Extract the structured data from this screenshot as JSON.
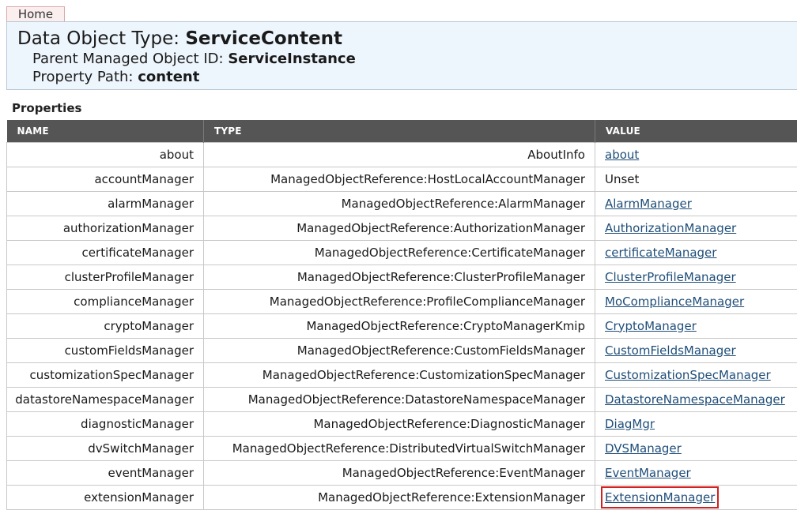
{
  "tab": {
    "label": "Home"
  },
  "header": {
    "title_prefix": "Data Object Type:",
    "title_value": "ServiceContent",
    "parent_label": "Parent Managed Object ID:",
    "parent_value": "ServiceInstance",
    "path_label": "Property Path:",
    "path_value": "content"
  },
  "section_label": "Properties",
  "table": {
    "headers": [
      "NAME",
      "TYPE",
      "VALUE"
    ],
    "rows": [
      {
        "name": "about",
        "type": "AboutInfo",
        "value": "about",
        "link": true
      },
      {
        "name": "accountManager",
        "type": "ManagedObjectReference:HostLocalAccountManager",
        "value": "Unset",
        "link": false
      },
      {
        "name": "alarmManager",
        "type": "ManagedObjectReference:AlarmManager",
        "value": "AlarmManager",
        "link": true
      },
      {
        "name": "authorizationManager",
        "type": "ManagedObjectReference:AuthorizationManager",
        "value": "AuthorizationManager",
        "link": true
      },
      {
        "name": "certificateManager",
        "type": "ManagedObjectReference:CertificateManager",
        "value": "certificateManager",
        "link": true
      },
      {
        "name": "clusterProfileManager",
        "type": "ManagedObjectReference:ClusterProfileManager",
        "value": "ClusterProfileManager",
        "link": true
      },
      {
        "name": "complianceManager",
        "type": "ManagedObjectReference:ProfileComplianceManager",
        "value": "MoComplianceManager",
        "link": true
      },
      {
        "name": "cryptoManager",
        "type": "ManagedObjectReference:CryptoManagerKmip",
        "value": "CryptoManager",
        "link": true
      },
      {
        "name": "customFieldsManager",
        "type": "ManagedObjectReference:CustomFieldsManager",
        "value": "CustomFieldsManager",
        "link": true
      },
      {
        "name": "customizationSpecManager",
        "type": "ManagedObjectReference:CustomizationSpecManager",
        "value": "CustomizationSpecManager",
        "link": true
      },
      {
        "name": "datastoreNamespaceManager",
        "type": "ManagedObjectReference:DatastoreNamespaceManager",
        "value": "DatastoreNamespaceManager",
        "link": true
      },
      {
        "name": "diagnosticManager",
        "type": "ManagedObjectReference:DiagnosticManager",
        "value": "DiagMgr",
        "link": true
      },
      {
        "name": "dvSwitchManager",
        "type": "ManagedObjectReference:DistributedVirtualSwitchManager",
        "value": "DVSManager",
        "link": true
      },
      {
        "name": "eventManager",
        "type": "ManagedObjectReference:EventManager",
        "value": "EventManager",
        "link": true
      },
      {
        "name": "extensionManager",
        "type": "ManagedObjectReference:ExtensionManager",
        "value": "ExtensionManager",
        "link": true,
        "highlighted": true
      }
    ]
  }
}
